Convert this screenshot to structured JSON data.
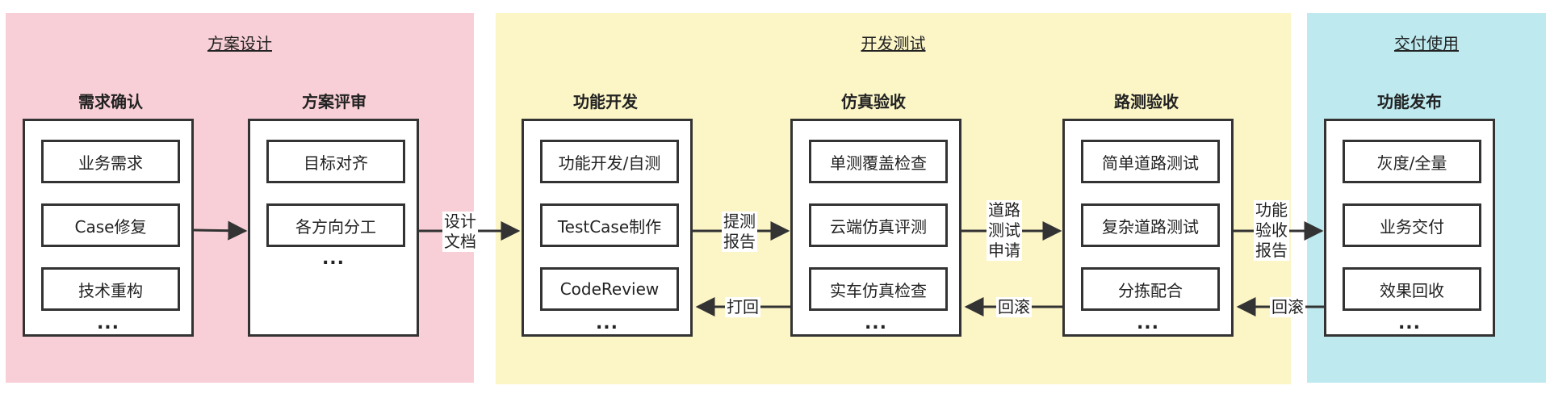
{
  "phases": [
    {
      "title": "方案设计",
      "color": "#f8cfd6"
    },
    {
      "title": "开发测试",
      "color": "#fcf6c7"
    },
    {
      "title": "交付使用",
      "color": "#bde9ef"
    }
  ],
  "stages": [
    {
      "title": "需求确认",
      "items": [
        "业务需求",
        "Case修复",
        "技术重构"
      ],
      "more": "..."
    },
    {
      "title": "方案评审",
      "items": [
        "目标对齐",
        "各方向分工"
      ],
      "more": "..."
    },
    {
      "title": "功能开发",
      "items": [
        "功能开发/自测",
        "TestCase制作",
        "CodeReview"
      ],
      "more": "..."
    },
    {
      "title": "仿真验收",
      "items": [
        "单测覆盖检查",
        "云端仿真评测",
        "实车仿真检查"
      ],
      "more": "..."
    },
    {
      "title": "路测验收",
      "items": [
        "简单道路测试",
        "复杂道路测试",
        "分拣配合"
      ],
      "more": "..."
    },
    {
      "title": "功能发布",
      "items": [
        "灰度/全量",
        "业务交付",
        "效果回收"
      ],
      "more": "..."
    }
  ],
  "connectors": {
    "design_doc": [
      "设计",
      "文档"
    ],
    "test_report": [
      "提测",
      "报告"
    ],
    "road_test_request": [
      "道路",
      "测试",
      "申请"
    ],
    "acceptance_report": [
      "功能",
      "验收",
      "报告"
    ],
    "reject": "打回",
    "rollback_1": "回滚",
    "rollback_2": "回滚"
  }
}
